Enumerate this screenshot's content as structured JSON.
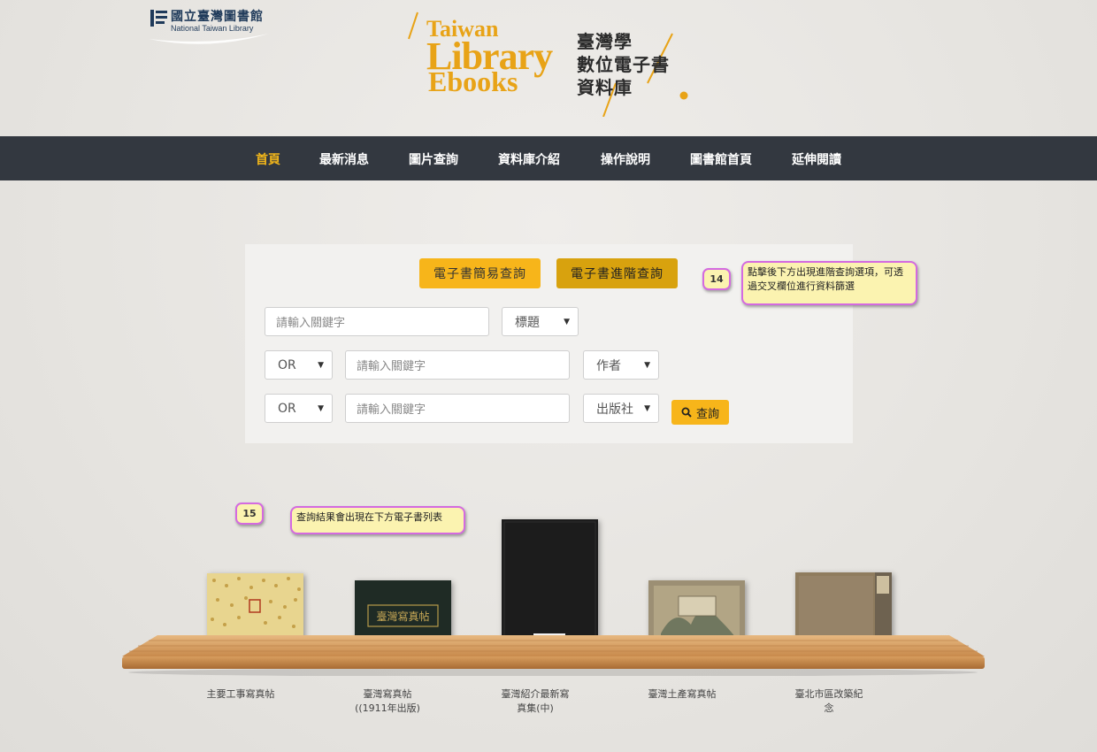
{
  "header": {
    "ntl_name_zh": "國立臺灣圖書館",
    "ntl_name_en": "National Taiwan Library",
    "brand_line1": "Taiwan",
    "brand_line2": "Library",
    "brand_line3": "Ebooks",
    "brand_zh_line1": "臺灣學",
    "brand_zh_line2": "數位電子書",
    "brand_zh_line3": "資料庫"
  },
  "nav": {
    "items": [
      {
        "label": "首頁",
        "active": true
      },
      {
        "label": "最新消息"
      },
      {
        "label": "圖片查詢"
      },
      {
        "label": "資料庫介紹"
      },
      {
        "label": "操作說明"
      },
      {
        "label": "圖書館首頁"
      },
      {
        "label": "延伸閱讀"
      }
    ]
  },
  "search": {
    "simple_tab": "電子書簡易查詢",
    "advanced_tab": "電子書進階查詢",
    "keyword_placeholder": "請輸入關鍵字",
    "row1_field": "標題",
    "row2_op": "OR",
    "row2_field": "作者",
    "row3_op": "OR",
    "row3_field": "出版社",
    "search_button": "查詢"
  },
  "annotations": {
    "badge14": "14",
    "note14": "點擊後下方出現進階查詢選項，可透過交叉欄位進行資料篩選",
    "badge15": "15",
    "note15": "查詢結果會出現在下方電子書列表"
  },
  "books": [
    {
      "title": "主要工事寫真帖"
    },
    {
      "title": "臺灣寫真帖\n((1911年出版)",
      "cover_title": "臺灣寫真帖"
    },
    {
      "title": "臺灣紹介最新寫\n真集(中)"
    },
    {
      "title": "臺灣土產寫真帖"
    },
    {
      "title": "臺北市區改築紀\n念"
    }
  ],
  "colors": {
    "accent": "#f7b51a",
    "nav_bg": "#333840",
    "annotation_border": "#d46ae0",
    "annotation_bg": "#fbf3b0"
  }
}
